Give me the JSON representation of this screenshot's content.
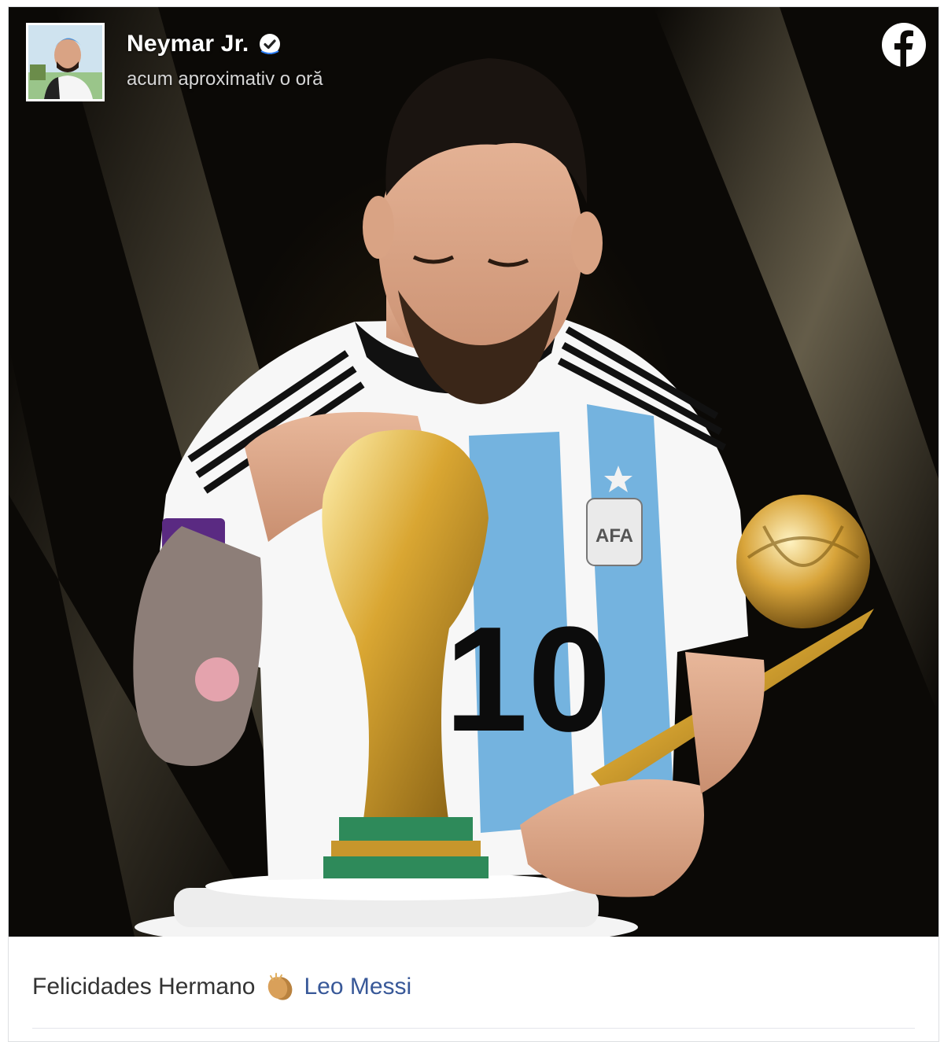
{
  "post": {
    "author": "Neymar Jr.",
    "timestamp": "acum aproximativ o oră",
    "caption_text": "Felicidades Hermano",
    "mention": "Leo Messi"
  },
  "icons": {
    "verified": "verified-badge-icon",
    "platform": "facebook-icon",
    "emoji": "clapping-hands-emoji"
  },
  "photo": {
    "jersey_number": "10",
    "badge_text": "AFA"
  },
  "colors": {
    "mention": "#385898",
    "caption": "#333333",
    "background": "#0b0906",
    "gold": "#d4a437",
    "jersey_blue": "#74b3df"
  }
}
